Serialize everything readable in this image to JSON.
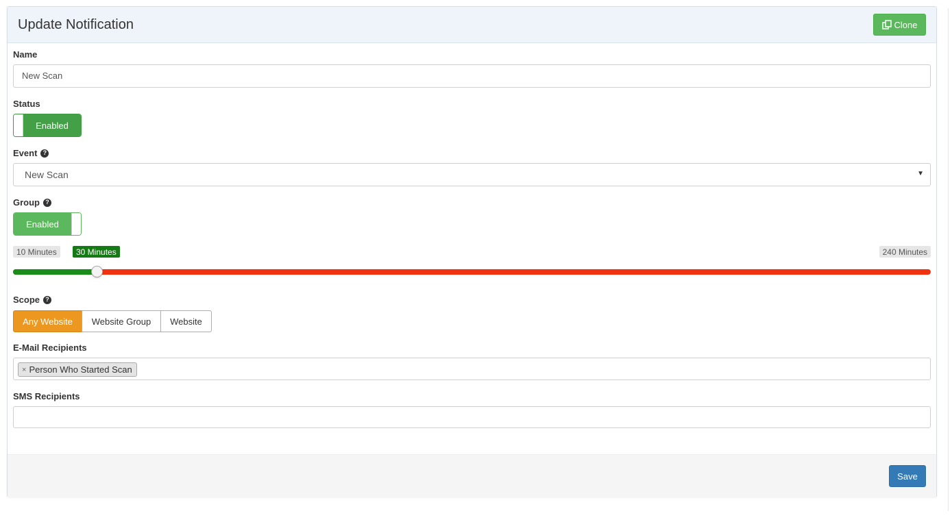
{
  "panel": {
    "title": "Update Notification",
    "clone_label": "Clone"
  },
  "form": {
    "name": {
      "label": "Name",
      "value": "New Scan"
    },
    "status": {
      "label": "Status",
      "toggle": "Enabled"
    },
    "event": {
      "label": "Event",
      "selected": "New Scan"
    },
    "group": {
      "label": "Group",
      "toggle": "Enabled",
      "slider": {
        "min_label": "10 Minutes",
        "value_label": "30 Minutes",
        "max_label": "240 Minutes",
        "min": 10,
        "value": 30,
        "max": 240
      }
    },
    "scope": {
      "label": "Scope",
      "options": [
        "Any Website",
        "Website Group",
        "Website"
      ],
      "selected": "Any Website"
    },
    "email": {
      "label": "E-Mail Recipients",
      "chips": [
        "Person Who Started Scan"
      ],
      "chip_remove": "×"
    },
    "sms": {
      "label": "SMS Recipients",
      "value": ""
    }
  },
  "footer": {
    "save_label": "Save"
  },
  "colors": {
    "success": "#5cb85c",
    "toggle_on": "#43a047",
    "slider_low": "#1a8c1a",
    "slider_high": "#ef3310",
    "scope_active": "#ec971f",
    "primary": "#337ab7"
  }
}
